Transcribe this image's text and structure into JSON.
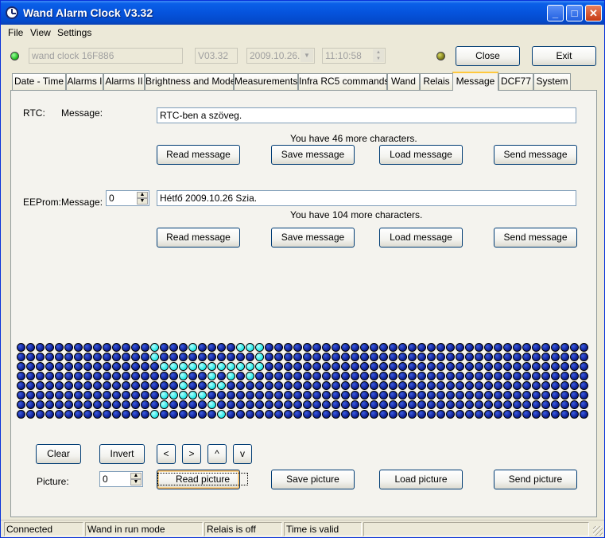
{
  "window": {
    "title": "Wand Alarm Clock V3.32"
  },
  "menu": [
    "File",
    "View",
    "Settings"
  ],
  "topbar": {
    "device_name": "wand clock 16F886",
    "version": "V03.32",
    "date": "2009.10.26.",
    "time": "11:10:58",
    "close_label": "Close",
    "exit_label": "Exit"
  },
  "tabs": [
    "Date - Time",
    "Alarms I",
    "Alarms II",
    "Brightness and Mode",
    "Measurements",
    "Infra RC5 commands",
    "Wand",
    "Relais",
    "Message",
    "DCF77",
    "System"
  ],
  "active_tab": "Message",
  "rtc": {
    "section_label": "RTC:",
    "message_label": "Message:",
    "message_value": "RTC-ben a szöveg.",
    "chars_info": "You have   46 more characters.",
    "read": "Read message",
    "save": "Save message",
    "load": "Load message",
    "send": "Send message"
  },
  "eeprom": {
    "section_label": "EEProm:",
    "message_label": "Message:",
    "index": "0",
    "message_value": "Hétfő 2009.10.26  Szia.",
    "chars_info": "You have  104 more characters.",
    "read": "Read message",
    "save": "Save message",
    "load": "Load message",
    "send": "Send message"
  },
  "matrix": {
    "on_color": "#1ee6e6",
    "off_color": "#0a1a8a",
    "cols": 60,
    "rows": 8,
    "lit": [
      [
        1,
        15
      ],
      [
        1,
        19
      ],
      [
        1,
        24
      ],
      [
        1,
        25
      ],
      [
        1,
        26
      ],
      [
        2,
        15
      ],
      [
        2,
        26
      ],
      [
        3,
        16
      ],
      [
        3,
        17
      ],
      [
        3,
        18
      ],
      [
        3,
        19
      ],
      [
        3,
        20
      ],
      [
        3,
        21
      ],
      [
        3,
        22
      ],
      [
        3,
        23
      ],
      [
        3,
        24
      ],
      [
        3,
        25
      ],
      [
        3,
        26
      ],
      [
        4,
        18
      ],
      [
        4,
        21
      ],
      [
        4,
        23
      ],
      [
        4,
        25
      ],
      [
        5,
        18
      ],
      [
        5,
        21
      ],
      [
        5,
        22
      ],
      [
        6,
        16
      ],
      [
        6,
        17
      ],
      [
        6,
        18
      ],
      [
        6,
        19
      ],
      [
        6,
        20
      ],
      [
        7,
        16
      ],
      [
        7,
        21
      ],
      [
        8,
        15
      ],
      [
        8,
        22
      ]
    ]
  },
  "picture": {
    "clear": "Clear",
    "invert": "Invert",
    "left": "<",
    "right": ">",
    "up": "^",
    "down": "v",
    "label": "Picture:",
    "index": "0",
    "read": "Read picture",
    "save": "Save picture",
    "load": "Load picture",
    "send": "Send picture"
  },
  "status": [
    "Connected",
    "Wand in run mode",
    "Relais is off",
    "Time is valid",
    ""
  ]
}
